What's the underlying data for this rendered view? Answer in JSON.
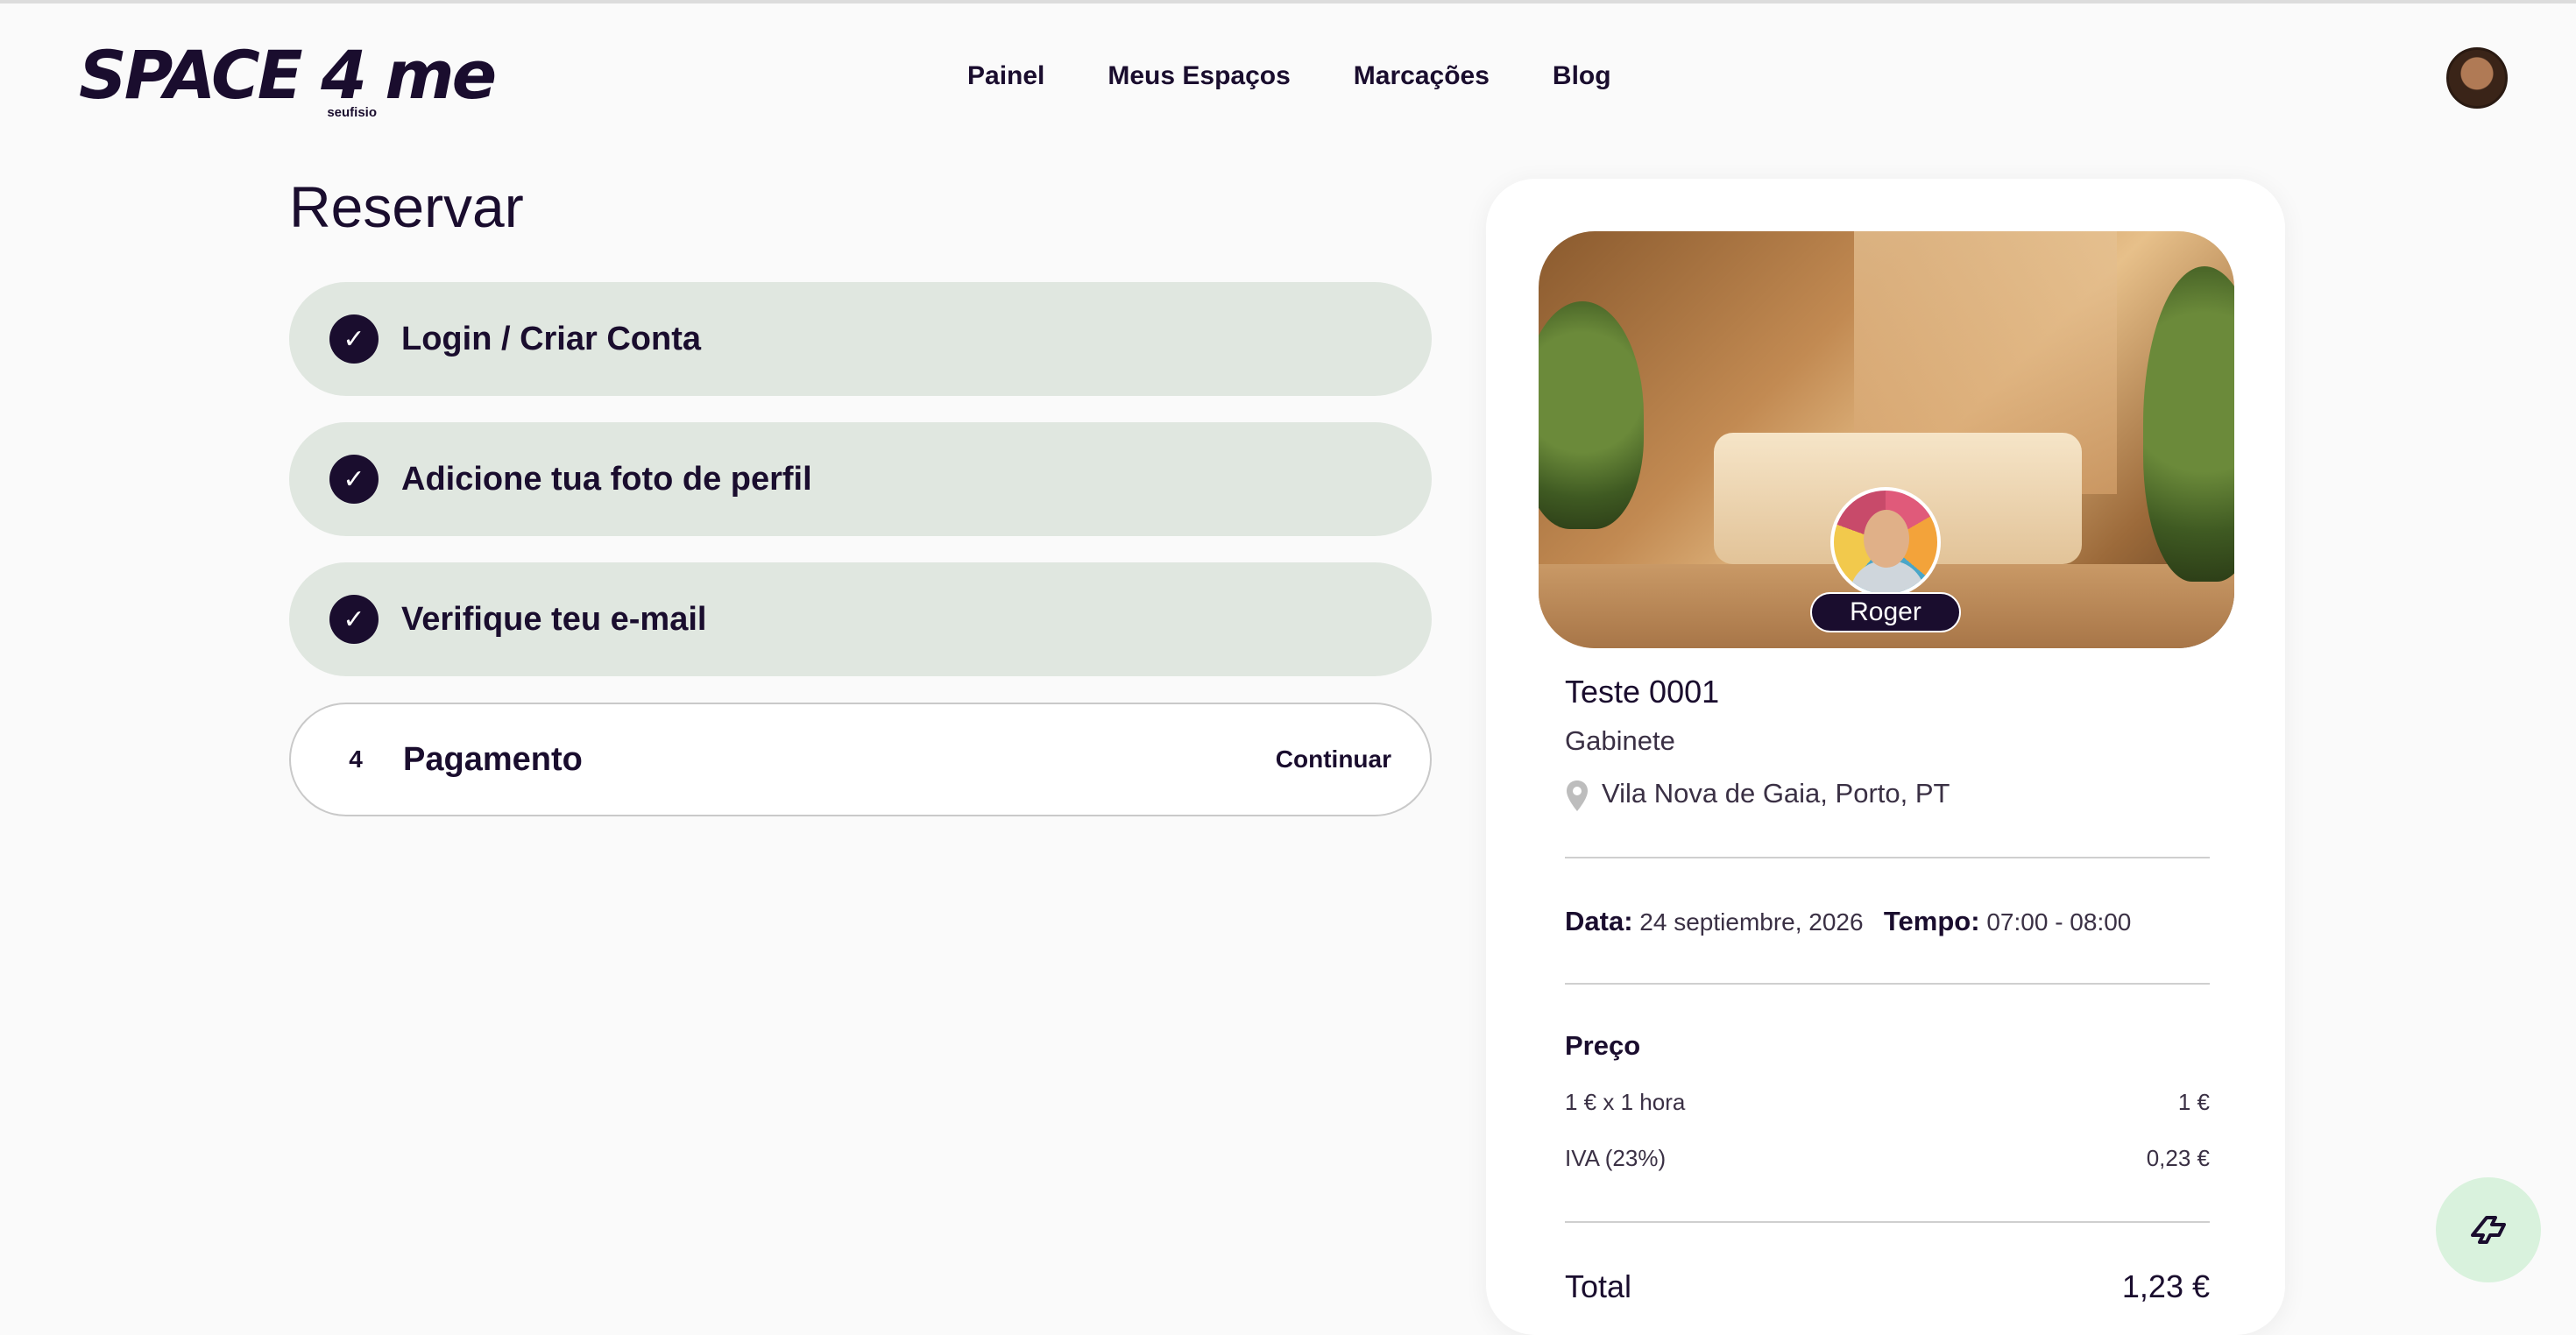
{
  "header": {
    "logo_text": "SPACE 4 me",
    "logo_subtext": "seufisio",
    "nav": [
      "Painel",
      "Meus Espaços",
      "Marcações",
      "Blog"
    ]
  },
  "page": {
    "title": "Reservar"
  },
  "steps": [
    {
      "label": "Login / Criar Conta",
      "status": "done"
    },
    {
      "label": "Adicione tua foto de perfil",
      "status": "done"
    },
    {
      "label": "Verifique teu e-mail",
      "status": "done"
    },
    {
      "number": "4",
      "label": "Pagamento",
      "status": "current",
      "action": "Continuar"
    }
  ],
  "card": {
    "host_name": "Roger",
    "space_name": "Teste 0001",
    "space_type": "Gabinete",
    "location": "Vila Nova de Gaia, Porto, PT",
    "date_label": "Data:",
    "date_value": "24 septiembre, 2026",
    "time_label": "Tempo:",
    "time_value": "07:00 - 08:00",
    "price_title": "Preço",
    "price_lines": [
      {
        "label": "1 € x 1 hora",
        "value": "1 €"
      },
      {
        "label": "IVA (23%)",
        "value": "0,23 €"
      }
    ],
    "total_label": "Total",
    "total_value": "1,23 €"
  },
  "colors": {
    "brand": "#1a0d2e",
    "step_done_bg": "#e0e7e0",
    "fab_bg": "#d9f2dd"
  },
  "icons": {
    "check": "check-icon",
    "pin": "location-pin-icon",
    "fab": "brand-mark-icon"
  }
}
